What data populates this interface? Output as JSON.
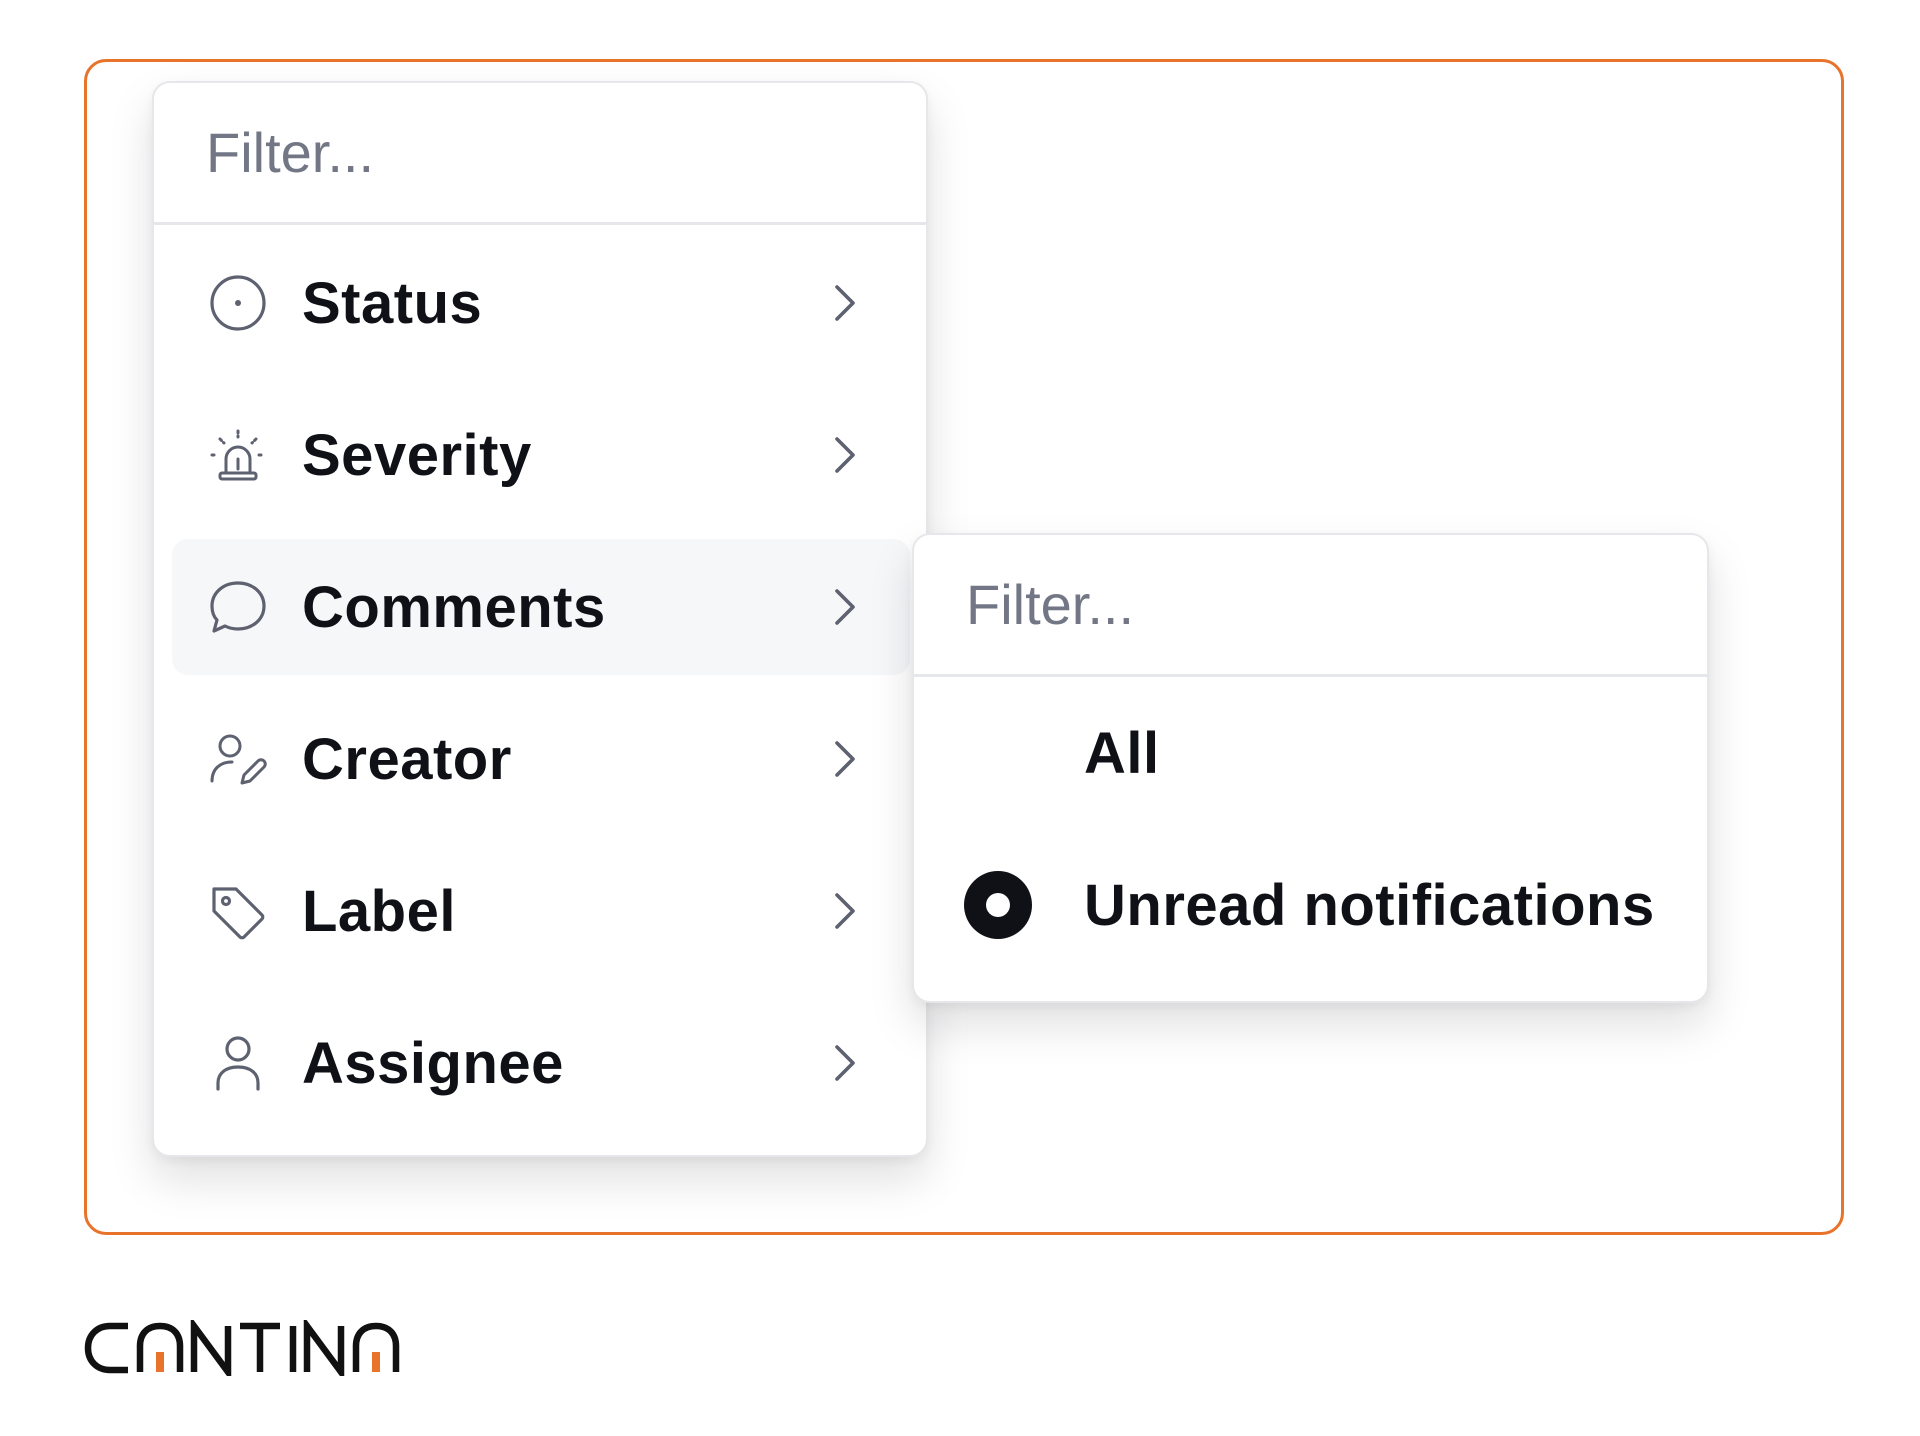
{
  "main_menu": {
    "filter_placeholder": "Filter...",
    "items": [
      {
        "label": "Status",
        "icon": "status-circle-icon"
      },
      {
        "label": "Severity",
        "icon": "siren-icon"
      },
      {
        "label": "Comments",
        "icon": "comment-bubble-icon",
        "hovered": true
      },
      {
        "label": "Creator",
        "icon": "user-pen-icon"
      },
      {
        "label": "Label",
        "icon": "tag-icon"
      },
      {
        "label": "Assignee",
        "icon": "user-icon"
      }
    ]
  },
  "submenu": {
    "parent": "Comments",
    "filter_placeholder": "Filter...",
    "options": [
      {
        "label": "All",
        "selected": false
      },
      {
        "label": "Unread notifications",
        "selected": true
      }
    ]
  },
  "brand": {
    "logo_text": "CANTINA",
    "colors": {
      "frame": "#e8732b",
      "logo_dark": "#111111",
      "logo_accent": "#e8732b"
    }
  }
}
